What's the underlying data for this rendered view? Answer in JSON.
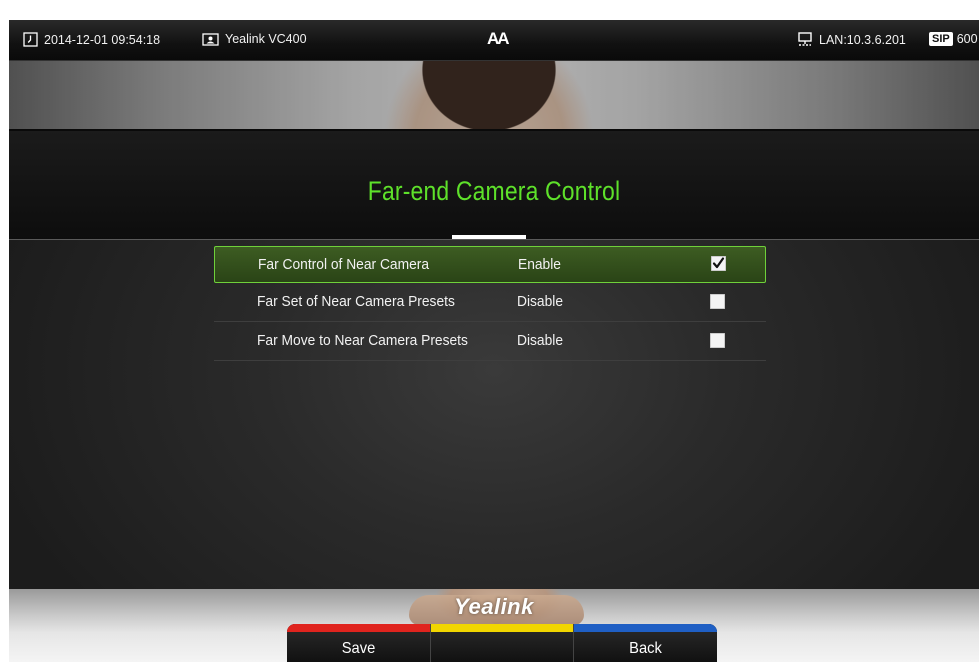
{
  "status_bar": {
    "datetime": "2014-12-01 09:54:18",
    "device_name": "Yealink VC400",
    "center_logo": "AA",
    "network": "LAN:10.3.6.201",
    "sip_badge": "SIP",
    "sip_account": "600"
  },
  "header": {
    "title": "Far-end Camera Control"
  },
  "settings": [
    {
      "label": "Far Control of Near Camera",
      "value": "Enable",
      "checked": true,
      "selected": true
    },
    {
      "label": "Far Set of Near Camera Presets",
      "value": "Disable",
      "checked": false,
      "selected": false
    },
    {
      "label": "Far Move to Near Camera Presets",
      "value": "Disable",
      "checked": false,
      "selected": false
    }
  ],
  "brand": "Yealink",
  "softkeys": {
    "red": {
      "label": "Save",
      "color": "#e0241e"
    },
    "yellow": {
      "label": "",
      "color": "#f1d600"
    },
    "blue": {
      "label": "Back",
      "color": "#1f5fc4"
    }
  },
  "colors": {
    "title": "#5ee12a",
    "selection_border": "#6fd13a"
  },
  "icons": {
    "datetime": "clock-icon",
    "device": "display-icon",
    "network": "network-icon",
    "checkbox_checked": "checkmark-icon"
  }
}
